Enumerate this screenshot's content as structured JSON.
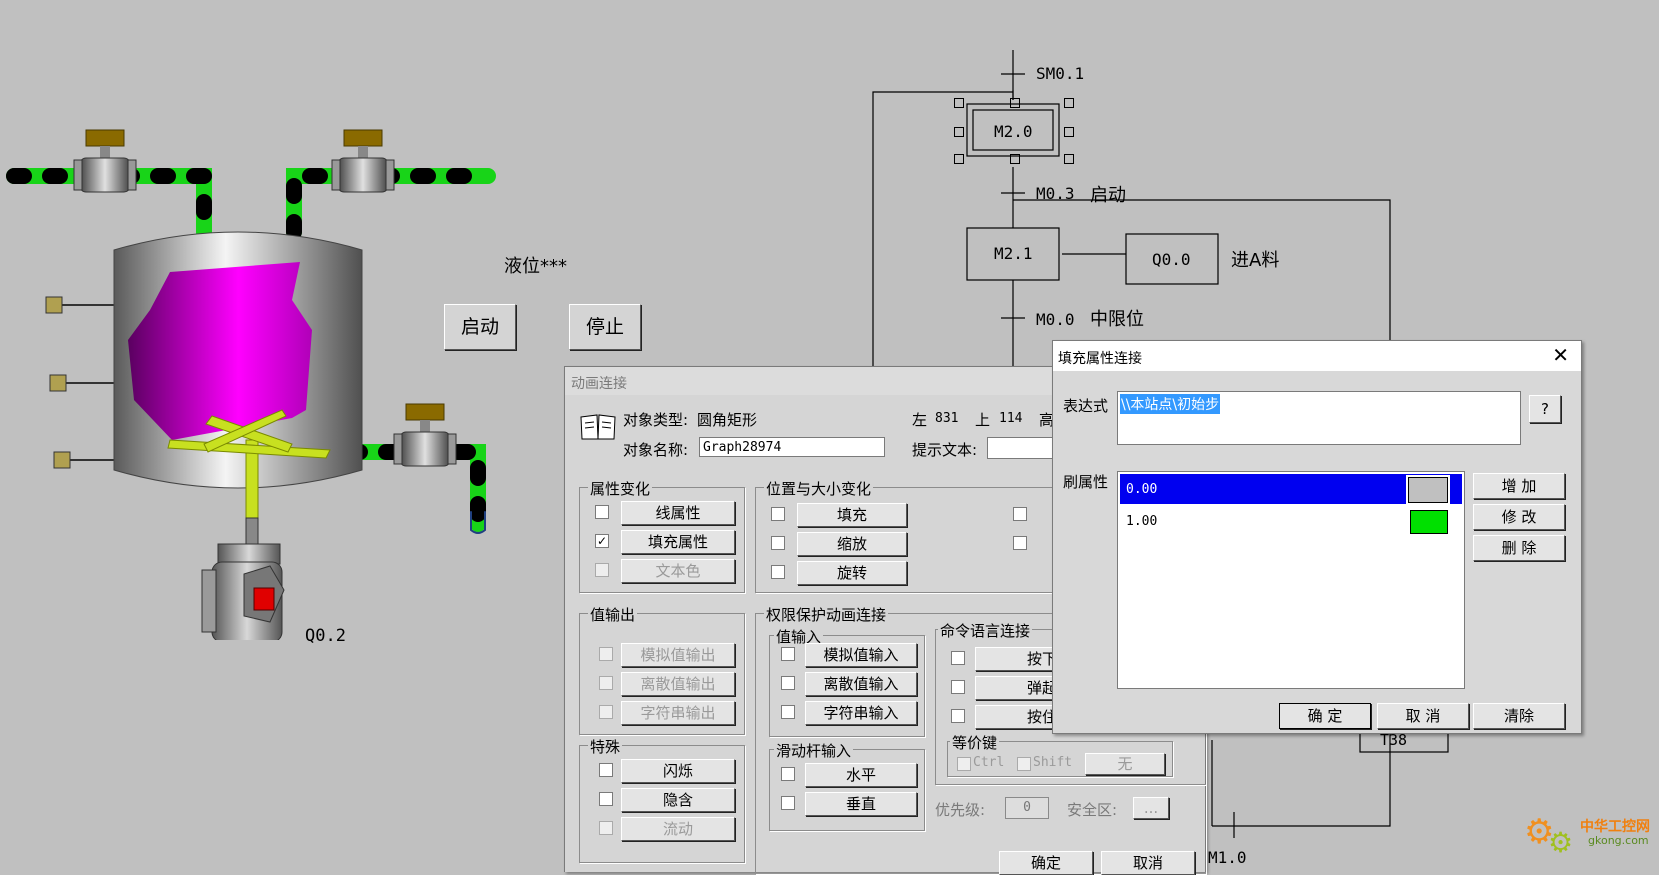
{
  "scada": {
    "level_label": "液位***",
    "start_button": "启动",
    "stop_button": "停止",
    "motor_label": "Q0.2"
  },
  "sfc": {
    "init_condition": "SM0.1",
    "step_m20": "M2.0",
    "trans1_code": "M0.3",
    "trans1_text": "启动",
    "step_m21": "M2.1",
    "action_q00": "Q0.0",
    "action_text": "进A料",
    "trans2_code": "M0.0",
    "trans2_text": "中限位",
    "timer": "T38",
    "bottom_code": "M1.0"
  },
  "anim_dialog": {
    "title": "动画连接",
    "object_type_label": "对象类型:",
    "object_type_value": "圆角矩形",
    "left_label": "左",
    "left_value": "831",
    "top_label": "上",
    "top_value": "114",
    "height_label": "高",
    "object_name_label": "对象名称:",
    "object_name_value": "Graph28974",
    "hint_label": "提示文本:",
    "groups": {
      "attr_change": "属性变化",
      "pos_size": "位置与大小变化",
      "value_output": "值输出",
      "permission": "权限保护动画连接",
      "value_input": "值输入",
      "command": "命令语言连接",
      "special": "特殊",
      "slider": "滑动杆输入",
      "equiv_key": "等价键"
    },
    "attr_buttons": [
      "线属性",
      "填充属性",
      "文本色"
    ],
    "pos_buttons": [
      "填充",
      "缩放",
      "旋转"
    ],
    "output_buttons": [
      "模拟值输出",
      "离散值输出",
      "字符串输出"
    ],
    "input_buttons": [
      "模拟值输入",
      "离散值输入",
      "字符串输入"
    ],
    "command_buttons": [
      "按下时",
      "弹起时",
      "按住时"
    ],
    "special_buttons": [
      "闪烁",
      "隐含",
      "流动"
    ],
    "slider_buttons": [
      "水平",
      "垂直"
    ],
    "ctrl_label": "Ctrl",
    "shift_label": "Shift",
    "none_button": "无",
    "priority_label": "优先级:",
    "priority_value": "0",
    "security_label": "安全区:",
    "security_button": "...",
    "ok_button": "确定",
    "cancel_button": "取消"
  },
  "fill_dialog": {
    "title": "填充属性连接",
    "expr_label": "表达式",
    "expr_value": "\\\\本站点\\初始步",
    "help_button": "?",
    "brush_label": "刷属性",
    "rows": [
      {
        "value": "0.00",
        "color": "#c0c0c0"
      },
      {
        "value": "1.00",
        "color": "#00e000"
      }
    ],
    "add_button": "增 加",
    "modify_button": "修 改",
    "delete_button": "删 除",
    "ok_button": "确 定",
    "cancel_button": "取 消",
    "clear_button": "清除"
  },
  "watermark": {
    "line1": "中华工控网",
    "line2": "gkong.com"
  }
}
